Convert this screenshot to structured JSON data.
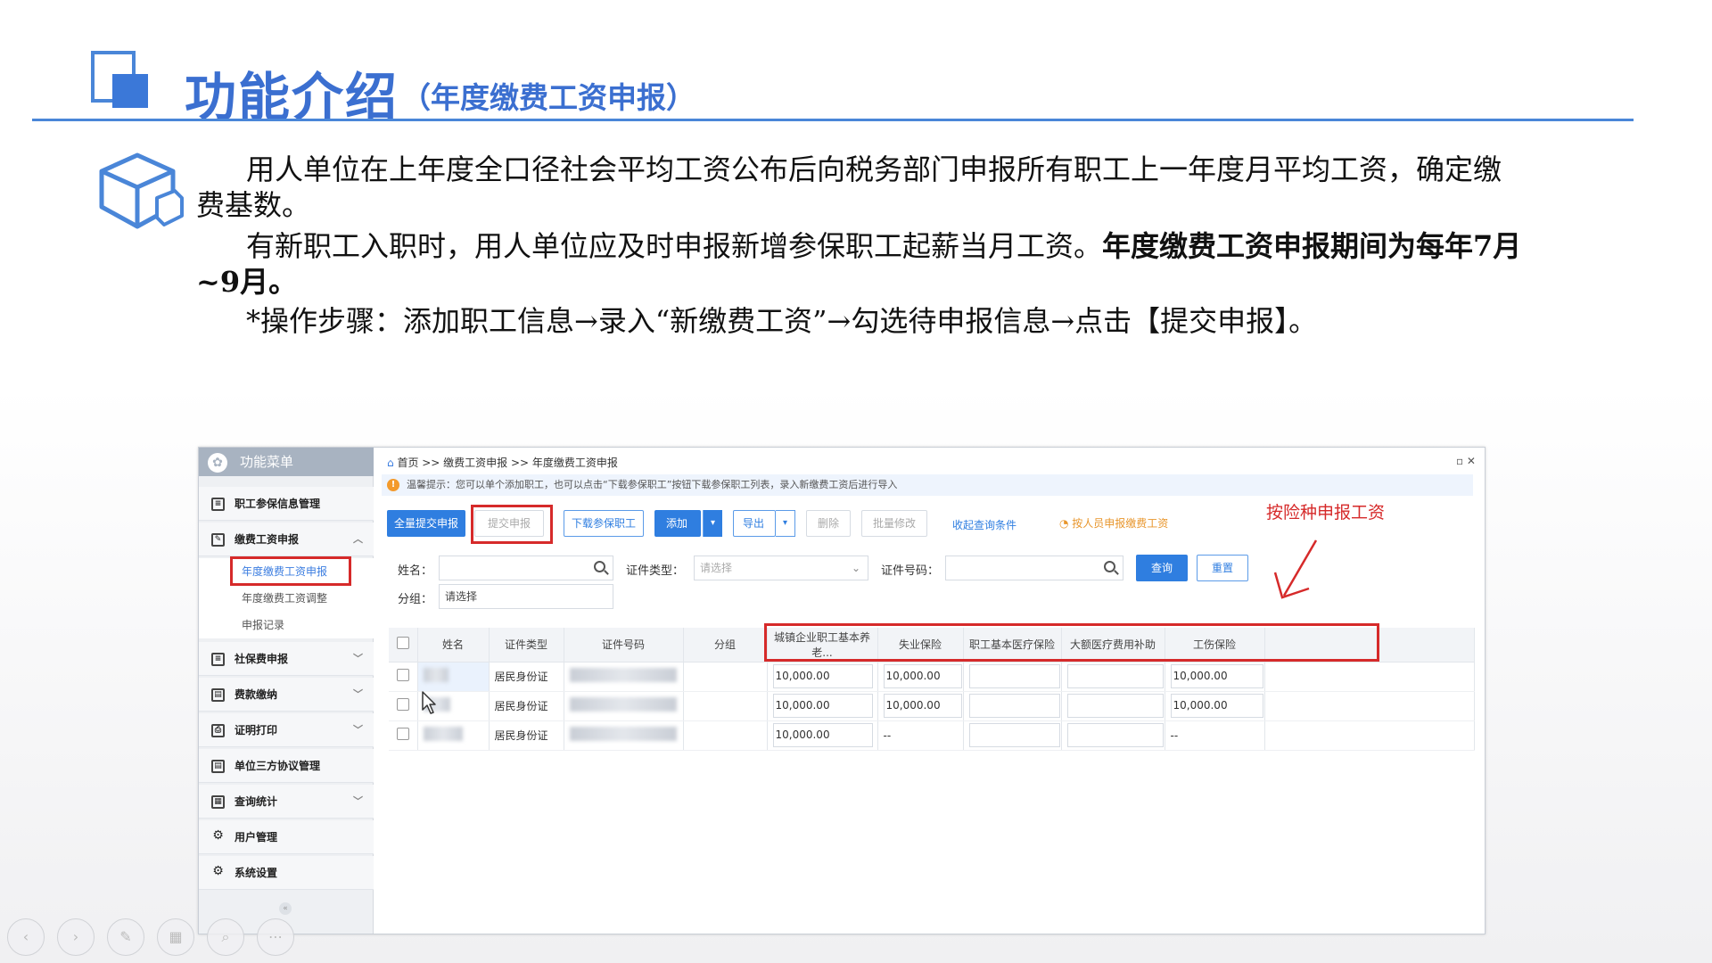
{
  "slide": {
    "title": "功能介绍",
    "subtitle": "（年度缴费工资申报）",
    "para1": "用人单位在上年度全口径社会平均工资公布后向税务部门申报所有职工上一年度月平均工资，确定缴费基数。",
    "para2_normal": "有新职工入职时，用人单位应及时申报新增参保职工起薪当月工资。",
    "para2_bold": "年度缴费工资申报期间为每年7月~9月。",
    "para3": "*操作步骤：添加职工信息→录入“新缴费工资”→勾选待申报信息→点击【提交申报】。",
    "cube_icon": "cube-icon",
    "accent_color": "#3b6fd0"
  },
  "app": {
    "sidebar": {
      "header": "功能菜单",
      "items": [
        {
          "label": "职工参保信息管理",
          "icon": "list-icon",
          "chevron": ""
        },
        {
          "label": "缴费工资申报",
          "icon": "edit-icon",
          "chevron": "︿"
        },
        {
          "label": "社保费申报",
          "icon": "list-icon",
          "chevron": "﹀"
        },
        {
          "label": "费款缴纳",
          "icon": "doc-icon",
          "chevron": "﹀"
        },
        {
          "label": "证明打印",
          "icon": "print-icon",
          "chevron": "﹀"
        },
        {
          "label": "单位三方协议管理",
          "icon": "doc-icon",
          "chevron": ""
        },
        {
          "label": "查询统计",
          "icon": "chart-icon",
          "chevron": "﹀"
        },
        {
          "label": "用户管理",
          "icon": "gear-icon",
          "chevron": ""
        },
        {
          "label": "系统设置",
          "icon": "gear-icon",
          "chevron": ""
        }
      ],
      "subitems": [
        "年度缴费工资申报",
        "年度缴费工资调整",
        "申报记录"
      ]
    },
    "breadcrumb": "首页 >> 缴费工资申报 >> 年度缴费工资申报",
    "breadcrumb_home": "首页",
    "window_controls": "▫ ✕",
    "tip": "温馨提示：您可以单个添加职工，也可以点击“下载参保职工”按钮下载参保职工列表，录入新缴费工资后进行导入",
    "buttons": {
      "submit_all": "全量提交申报",
      "submit": "提交申报",
      "download": "下载参保职工",
      "add": "添加",
      "export": "导出",
      "delete": "删除",
      "batch_edit": "批量修改",
      "collapse": "收起查询条件",
      "by_person": "按人员申报缴费工资",
      "query": "查询",
      "reset": "重置"
    },
    "annotation": "按险种申报工资",
    "filters": {
      "name_label": "姓名：",
      "idtype_label": "证件类型：",
      "idtype_placeholder": "请选择",
      "idno_label": "证件号码：",
      "group_label": "分组：",
      "group_placeholder": "请选择"
    },
    "table": {
      "headers": [
        "姓名",
        "证件类型",
        "证件号码",
        "分组",
        "城镇企业职工基本养老...",
        "失业保险",
        "职工基本医疗保险",
        "大额医疗费用补助",
        "工伤保险"
      ],
      "rows": [
        {
          "idtype": "居民身份证",
          "pension": "10,000.00",
          "unemployment": "10,000.00",
          "medical": "",
          "large_medical": "",
          "injury": "10,000.00"
        },
        {
          "idtype": "居民身份证",
          "pension": "10,000.00",
          "unemployment": "10,000.00",
          "medical": "",
          "large_medical": "",
          "injury": "10,000.00"
        },
        {
          "idtype": "居民身份证",
          "pension": "10,000.00",
          "unemployment": "--",
          "medical": "",
          "large_medical": "",
          "injury": "--"
        }
      ]
    }
  }
}
